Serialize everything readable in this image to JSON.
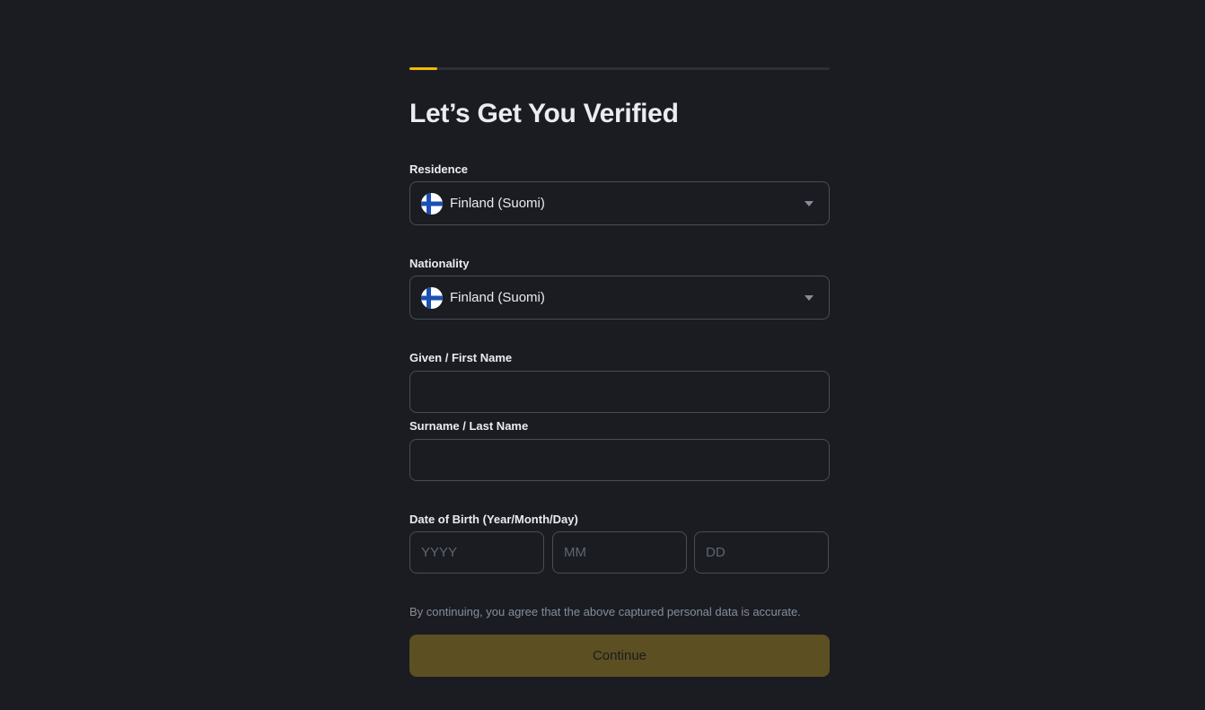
{
  "progress": {
    "step": 1,
    "fraction": 0.066
  },
  "title": "Let’s Get You Verified",
  "residence": {
    "label": "Residence",
    "value": "Finland (Suomi)",
    "flag": "finland-flag-icon"
  },
  "nationality": {
    "label": "Nationality",
    "value": "Finland (Suomi)",
    "flag": "finland-flag-icon"
  },
  "first_name": {
    "label": "Given / First Name",
    "value": ""
  },
  "last_name": {
    "label": "Surname / Last Name",
    "value": ""
  },
  "dob": {
    "label": "Date of Birth (Year/Month/Day)",
    "year_placeholder": "YYYY",
    "month_placeholder": "MM",
    "day_placeholder": "DD"
  },
  "disclaimer": "By continuing, you agree that the above captured personal data is accurate.",
  "continue_label": "Continue",
  "colors": {
    "background": "#1b1c21",
    "accent": "#f0b90b",
    "button_disabled": "#5c4f22",
    "border": "#474d57"
  }
}
